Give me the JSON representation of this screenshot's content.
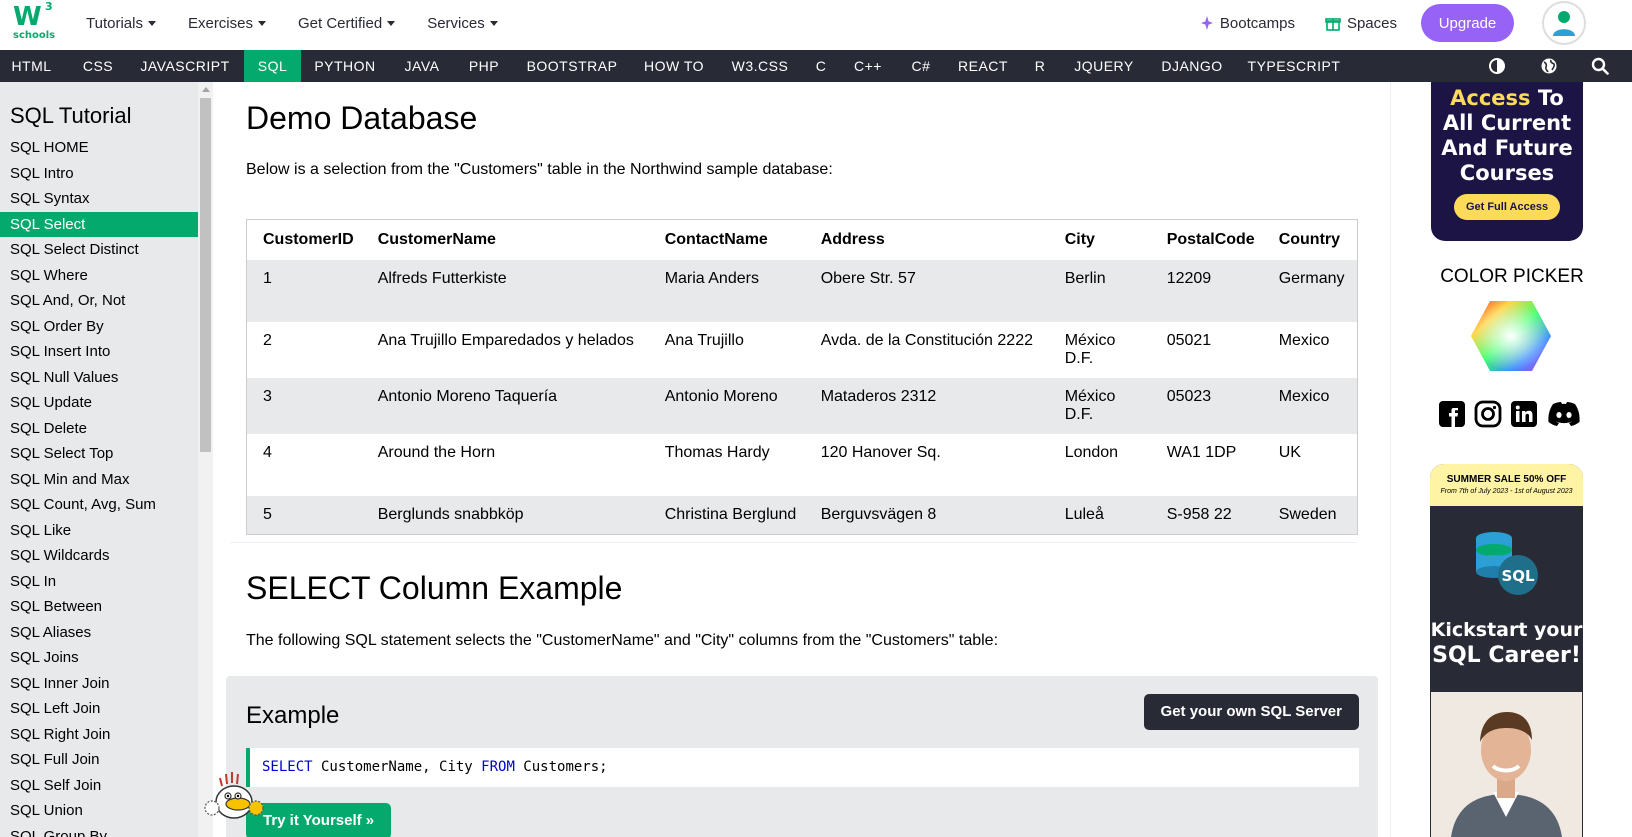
{
  "logo": {
    "mark": "W",
    "sup": "3",
    "sub": "schools"
  },
  "topmenu": [
    {
      "label": "Tutorials"
    },
    {
      "label": "Exercises"
    },
    {
      "label": "Get Certified"
    },
    {
      "label": "Services"
    }
  ],
  "topright": {
    "bootcamps": "Bootcamps",
    "spaces": "Spaces",
    "upgrade": "Upgrade"
  },
  "navbar": [
    "HTML",
    "CSS",
    "JAVASCRIPT",
    "SQL",
    "PYTHON",
    "JAVA",
    "PHP",
    "BOOTSTRAP",
    "HOW TO",
    "W3.CSS",
    "C",
    "C++",
    "C#",
    "REACT",
    "R",
    "JQUERY",
    "DJANGO",
    "TYPESCRIPT"
  ],
  "sidebar": {
    "title": "SQL Tutorial",
    "items": [
      "SQL HOME",
      "SQL Intro",
      "SQL Syntax",
      "SQL Select",
      "SQL Select Distinct",
      "SQL Where",
      "SQL And, Or, Not",
      "SQL Order By",
      "SQL Insert Into",
      "SQL Null Values",
      "SQL Update",
      "SQL Delete",
      "SQL Select Top",
      "SQL Min and Max",
      "SQL Count, Avg, Sum",
      "SQL Like",
      "SQL Wildcards",
      "SQL In",
      "SQL Between",
      "SQL Aliases",
      "SQL Joins",
      "SQL Inner Join",
      "SQL Left Join",
      "SQL Right Join",
      "SQL Full Join",
      "SQL Self Join",
      "SQL Union",
      "SQL Group By"
    ],
    "active": "SQL Select"
  },
  "main": {
    "demo_heading": "Demo Database",
    "demo_intro": "Below is a selection from the \"Customers\" table in the Northwind sample database:",
    "table": {
      "headers": [
        "CustomerID",
        "CustomerName",
        "ContactName",
        "Address",
        "City",
        "PostalCode",
        "Country"
      ],
      "rows": [
        [
          "1",
          "Alfreds Futterkiste",
          "Maria Anders",
          "Obere Str. 57",
          "Berlin",
          "12209",
          "Germany"
        ],
        [
          "2",
          "Ana Trujillo Emparedados y helados",
          "Ana Trujillo",
          "Avda. de la Constitución 2222",
          "México D.F.",
          "05021",
          "Mexico"
        ],
        [
          "3",
          "Antonio Moreno Taquería",
          "Antonio Moreno",
          "Mataderos 2312",
          "México D.F.",
          "05023",
          "Mexico"
        ],
        [
          "4",
          "Around the Horn",
          "Thomas Hardy",
          "120 Hanover Sq.",
          "London",
          "WA1 1DP",
          "UK"
        ],
        [
          "5",
          "Berglunds snabbköp",
          "Christina Berglund",
          "Berguvsvägen 8",
          "Luleå",
          "S-958 22",
          "Sweden"
        ]
      ]
    },
    "select_heading": "SELECT Column Example",
    "select_intro": "The following SQL statement selects the \"CustomerName\" and \"City\" columns from the \"Customers\" table:",
    "example": {
      "title": "Example",
      "own_server": "Get your own SQL Server",
      "code": {
        "kw1": "SELECT",
        "mid": " CustomerName, City ",
        "kw2": "FROM",
        "end": " Customers;"
      },
      "try_it": "Try it Yourself »"
    }
  },
  "rightcol": {
    "promo1": {
      "line1a": "Access",
      "line1b": " To",
      "line2": "All Current",
      "line3": "And Future",
      "line4": "Courses",
      "cta": "Get Full Access"
    },
    "color_picker": "COLOR PICKER",
    "promo2": {
      "sale": "SUMMER SALE 50% OFF",
      "dates": "From 7th of July 2023 - 1st of August 2023",
      "badge": "SQL",
      "line1": "Kickstart your",
      "line2": "SQL Career!"
    }
  },
  "colors": {
    "accent": "#04AA6D",
    "nav": "#282a35",
    "upgrade": "#9763f6",
    "sidebar": "#e7e9eb"
  }
}
